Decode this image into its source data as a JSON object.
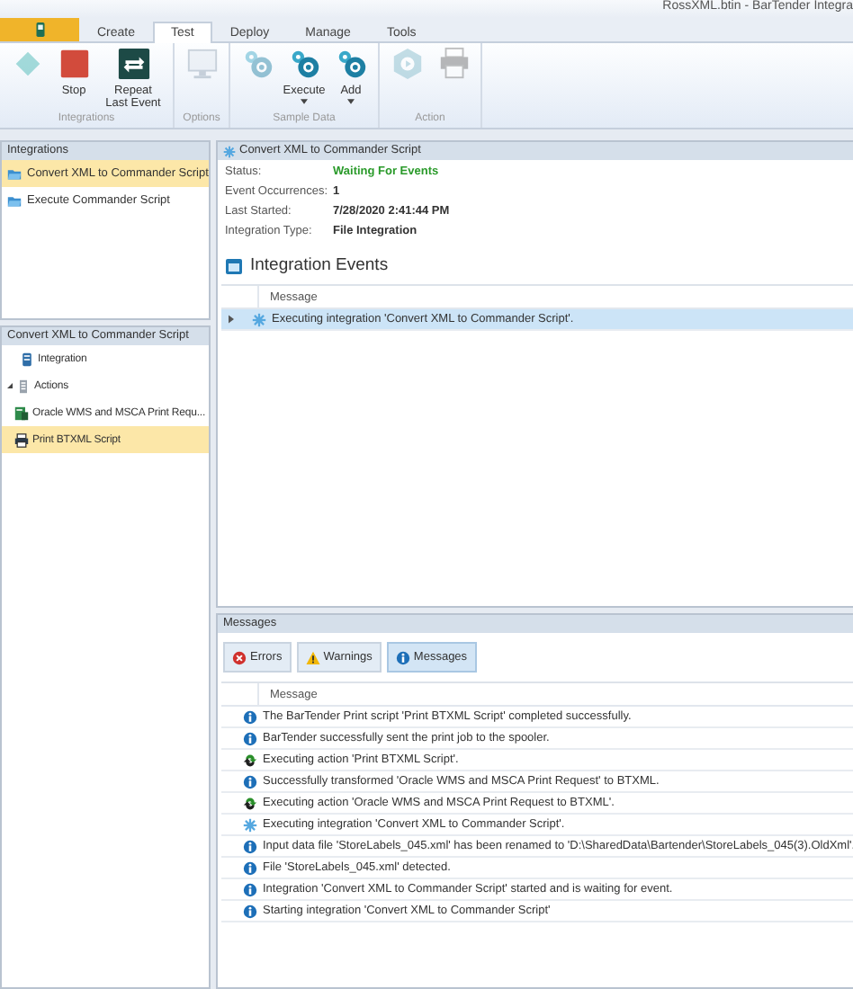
{
  "window": {
    "title": "RossXML.btin - BarTender Integra"
  },
  "ribbon_tabs": [
    {
      "label": "Create",
      "selected": false
    },
    {
      "label": "Test",
      "selected": true
    },
    {
      "label": "Deploy",
      "selected": false
    },
    {
      "label": "Manage",
      "selected": false
    },
    {
      "label": "Tools",
      "selected": false
    }
  ],
  "ribbon_groups": [
    {
      "label": "Integrations",
      "buttons": [
        {
          "kind": "start",
          "disabled": true
        },
        {
          "kind": "stop",
          "label": "Stop",
          "disabled": false
        },
        {
          "kind": "repeat",
          "label": "Repeat Last Event",
          "disabled": false
        }
      ]
    },
    {
      "label": "Options",
      "buttons": [
        {
          "kind": "monitor",
          "disabled": true
        }
      ]
    },
    {
      "label": "Sample Data",
      "buttons": [
        {
          "kind": "gears",
          "disabled": true
        },
        {
          "kind": "gears",
          "label": "Execute",
          "dropdown": true,
          "disabled": false
        },
        {
          "kind": "gears",
          "label": "Add",
          "dropdown": true,
          "disabled": false
        }
      ]
    },
    {
      "label": "Action",
      "buttons": [
        {
          "kind": "hexagon",
          "disabled": true
        },
        {
          "kind": "printer",
          "disabled": true
        }
      ]
    }
  ],
  "integrations": {
    "title": "Integrations",
    "items": [
      {
        "label": "Convert XML to Commander Script",
        "selected": true
      },
      {
        "label": "Execute Commander Script",
        "selected": false
      }
    ]
  },
  "tree": {
    "title": "Convert XML to Commander Script",
    "items": [
      {
        "kind": "integration",
        "label": "Integration",
        "selected": false
      },
      {
        "kind": "actions",
        "label": "Actions",
        "expanded": true,
        "selected": false,
        "children": [
          {
            "kind": "transform",
            "label": "Oracle WMS and MSCA Print Requ...",
            "selected": false
          },
          {
            "kind": "print",
            "label": "Print BTXML Script",
            "selected": true
          }
        ]
      }
    ]
  },
  "details": {
    "title": "Convert XML to Commander Script",
    "fields": [
      {
        "label": "Status:",
        "value": "Waiting For Events",
        "kind": "status"
      },
      {
        "label": "Event Occurrences:",
        "value": "1",
        "kind": "plain"
      },
      {
        "label": "Last Started:",
        "value": "7/28/2020 2:41:44 PM",
        "kind": "plain"
      },
      {
        "label": "Integration Type:",
        "value": "File Integration",
        "kind": "plain"
      }
    ],
    "events_heading": "Integration Events",
    "events_column": "Message",
    "events": [
      {
        "kind": "integration",
        "message": "Executing integration 'Convert XML to Commander Script'.",
        "selected": true
      }
    ]
  },
  "messages": {
    "title": "Messages",
    "filters": [
      {
        "kind": "error",
        "label": "Errors",
        "selected": false
      },
      {
        "kind": "warning",
        "label": "Warnings",
        "selected": false
      },
      {
        "kind": "info",
        "label": "Messages",
        "selected": true
      }
    ],
    "column": "Message",
    "rows": [
      {
        "kind": "info",
        "message": "The BarTender Print script 'Print BTXML Script' completed successfully."
      },
      {
        "kind": "info",
        "message": "BarTender successfully sent the print job to the spooler."
      },
      {
        "kind": "action",
        "message": "Executing action 'Print BTXML Script'."
      },
      {
        "kind": "info",
        "message": "Successfully transformed 'Oracle WMS and MSCA Print Request' to BTXML."
      },
      {
        "kind": "action",
        "message": "Executing action 'Oracle WMS and MSCA Print Request to BTXML'."
      },
      {
        "kind": "integration",
        "message": "Executing integration 'Convert XML to Commander Script'."
      },
      {
        "kind": "info",
        "message": "Input data file 'StoreLabels_045.xml' has been renamed to 'D:\\SharedData\\Bartender\\StoreLabels_045(3).OldXml'."
      },
      {
        "kind": "info",
        "message": "File 'StoreLabels_045.xml' detected."
      },
      {
        "kind": "info",
        "message": "Integration 'Convert XML to Commander Script' started and is waiting for event."
      },
      {
        "kind": "info",
        "message": "Starting integration 'Convert XML to Commander Script'"
      }
    ]
  }
}
